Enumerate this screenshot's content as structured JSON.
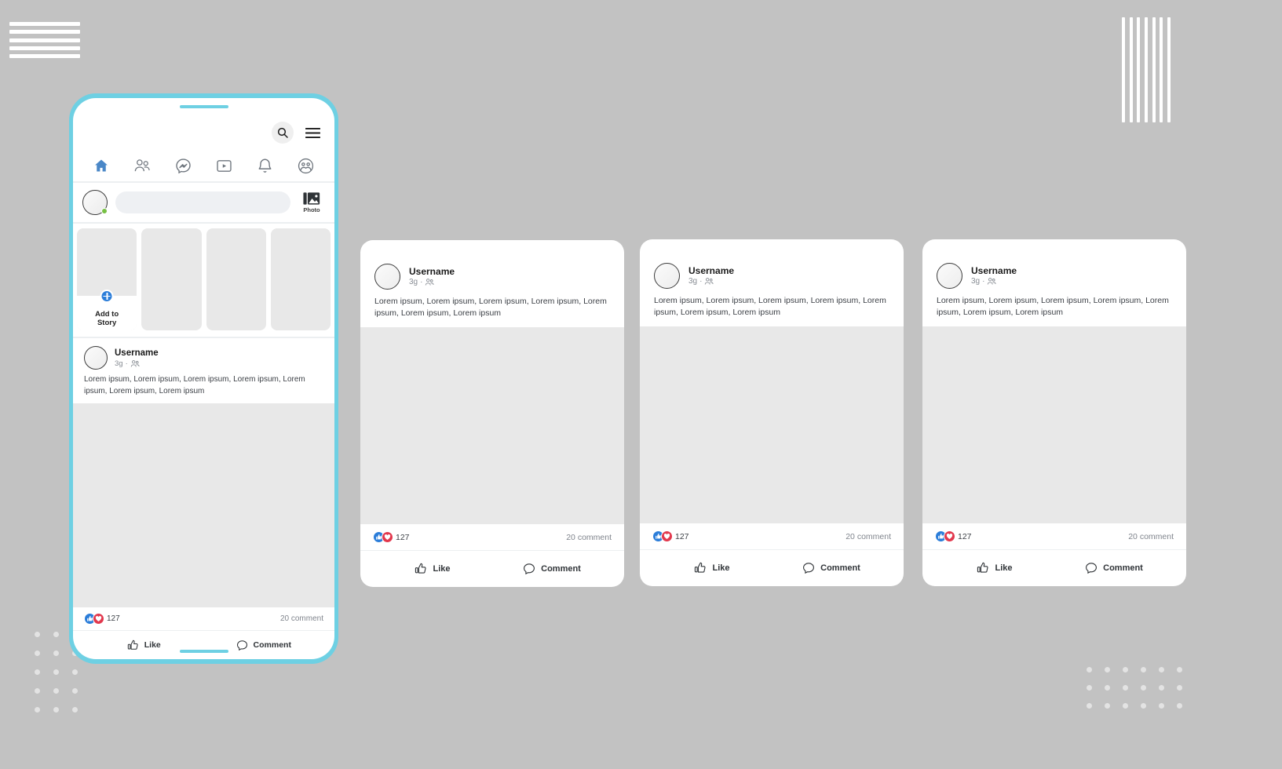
{
  "theme": {
    "background": "#c2c2c2",
    "phone_frame": "#6ed0e3",
    "accent_blue": "#2b7dd9",
    "like_blue": "#2b7dd9",
    "love_red": "#e2384d",
    "card_white": "#ffffff",
    "placeholder_gray": "#e8e8e8"
  },
  "phone": {
    "topbar": {
      "search_icon": "search-icon",
      "menu_icon": "hamburger-menu-icon"
    },
    "nav": [
      {
        "key": "home",
        "icon": "home-icon",
        "active": true
      },
      {
        "key": "friends",
        "icon": "friends-icon",
        "active": false
      },
      {
        "key": "messenger",
        "icon": "messenger-icon",
        "active": false
      },
      {
        "key": "watch",
        "icon": "video-watch-icon",
        "active": false
      },
      {
        "key": "notifications",
        "icon": "bell-icon",
        "active": false
      },
      {
        "key": "groups",
        "icon": "groups-icon",
        "active": false
      }
    ],
    "composer": {
      "placeholder": "",
      "value": "",
      "photo_label": "Photo",
      "photo_icon": "photo-image-icon",
      "avatar_icon": "user-avatar",
      "status_icon": "online-status-dot"
    },
    "stories": {
      "add_story_label": "Add to\nStory",
      "add_story_line1": "Add to",
      "add_story_line2": "Story",
      "plus_icon": "plus-circle-icon",
      "count": 4
    },
    "post": {
      "username": "Username",
      "time": "3g",
      "separator": "·",
      "audience_icon": "friends-audience-icon",
      "body": "Lorem ipsum, Lorem ipsum, Lorem ipsum, Lorem ipsum, Lorem ipsum, Lorem ipsum, Lorem ipsum",
      "reactions": {
        "like_icon": "thumbs-up-reaction-icon",
        "love_icon": "heart-reaction-icon",
        "count": "127"
      },
      "comments_label": "20 comment",
      "actions": [
        {
          "key": "like",
          "label": "Like",
          "icon": "thumbs-up-outline-icon"
        },
        {
          "key": "comment",
          "label": "Comment",
          "icon": "comment-bubble-icon"
        }
      ]
    }
  },
  "cards": [
    {
      "username": "Username",
      "time": "3g",
      "separator": "·",
      "body": "Lorem ipsum, Lorem ipsum, Lorem ipsum, Lorem ipsum, Lorem ipsum, Lorem ipsum, Lorem ipsum",
      "reaction_count": "127",
      "comments_label": "20 comment",
      "like_label": "Like",
      "comment_label": "Comment"
    },
    {
      "username": "Username",
      "time": "3g",
      "separator": "·",
      "body": "Lorem ipsum, Lorem ipsum, Lorem ipsum, Lorem ipsum, Lorem ipsum, Lorem ipsum, Lorem ipsum",
      "reaction_count": "127",
      "comments_label": "20 comment",
      "like_label": "Like",
      "comment_label": "Comment"
    },
    {
      "username": "Username",
      "time": "3g",
      "separator": "·",
      "body": "Lorem ipsum, Lorem ipsum, Lorem ipsum, Lorem ipsum, Lorem ipsum, Lorem ipsum, Lorem ipsum",
      "reaction_count": "127",
      "comments_label": "20 comment",
      "like_label": "Like",
      "comment_label": "Comment"
    }
  ],
  "decor": {
    "top_left_lines": 5,
    "top_right_lines": 7,
    "bottom_left_dots": 15,
    "bottom_right_dots": 18
  }
}
